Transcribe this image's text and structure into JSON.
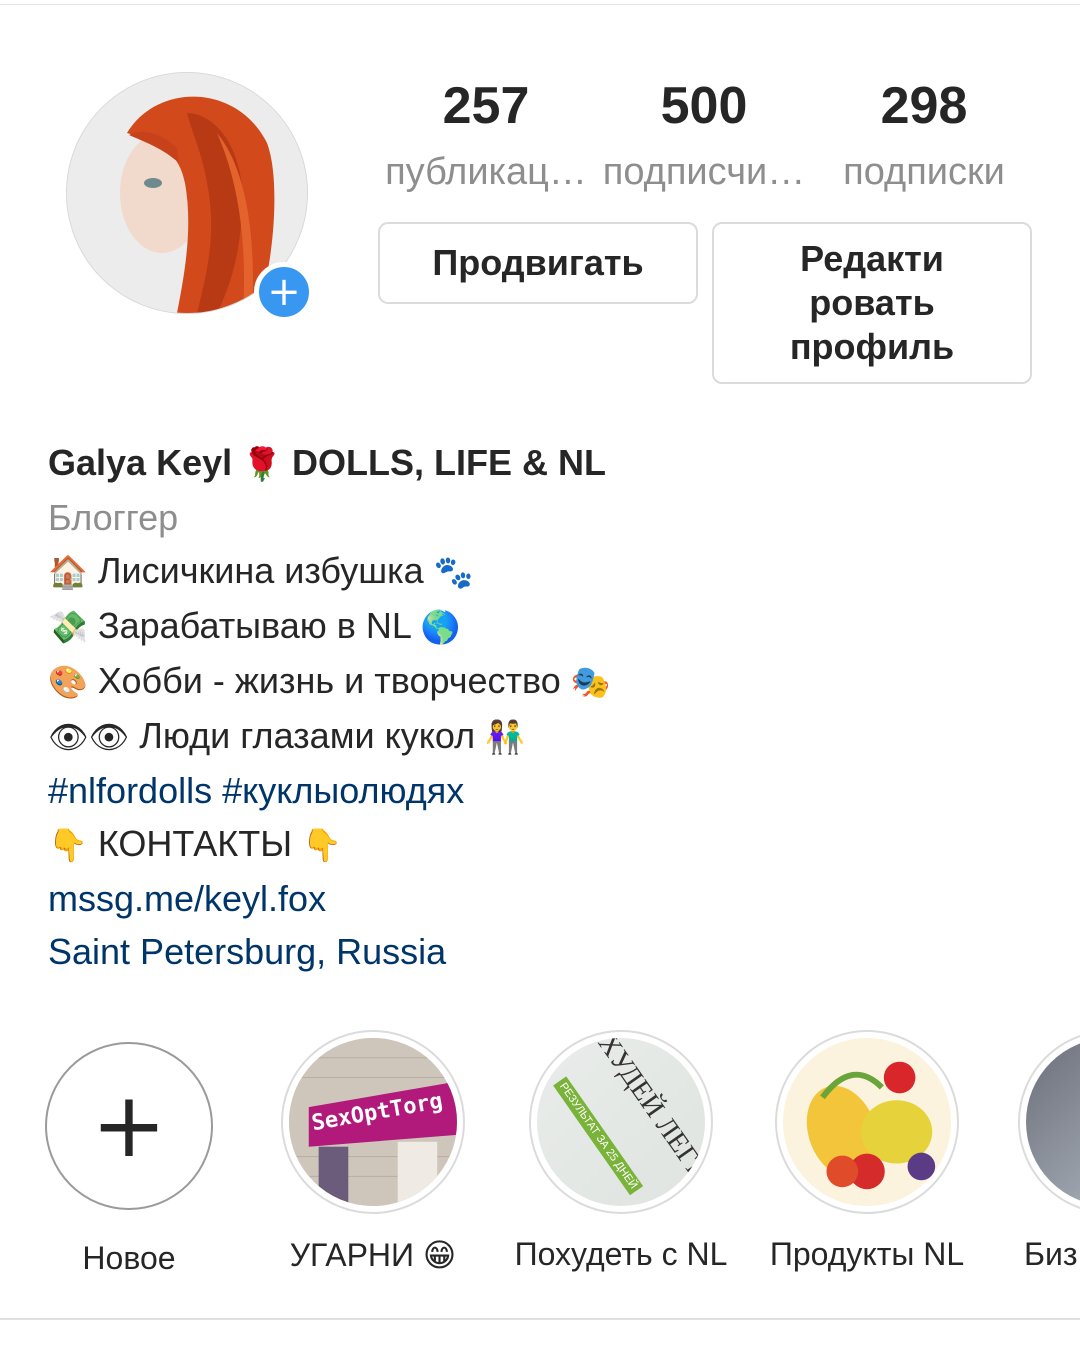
{
  "profile": {
    "stats": [
      {
        "value": "257",
        "label": "публикац…"
      },
      {
        "value": "500",
        "label": "подписчи…"
      },
      {
        "value": "298",
        "label": "подписки"
      }
    ],
    "buttons": {
      "promote": "Продвигать",
      "edit": "Редакти\nровать\nпрофиль"
    },
    "add_icon": "plus-icon"
  },
  "bio": {
    "name": "Galya Keyl",
    "name_emoji": "🌹",
    "name_rest": "DOLLS, LIFE & NL",
    "category": "Блоггер",
    "lines": [
      {
        "emoji_start": "🏠",
        "text": "Лисичкина избушка",
        "emoji_end": "🐾"
      },
      {
        "emoji_start": "💸",
        "text": "Зарабатываю в NL",
        "emoji_end": "🌎"
      },
      {
        "emoji_start": "🎨",
        "text": "Хобби - жизнь и творчество",
        "emoji_end": "🎭"
      },
      {
        "emoji_start": "👁👁",
        "text": "Люди глазами кукол",
        "emoji_end": "👫"
      }
    ],
    "hashtags": "#nlfordolls #куклыолюдях",
    "contacts": {
      "emoji_start": "👇",
      "text": "КОНТАКТЫ",
      "emoji_end": "👇"
    },
    "link": "mssg.me/keyl.fox",
    "location": "Saint Petersburg, Russia"
  },
  "highlights": [
    {
      "label": "Новое"
    },
    {
      "label": "УГАРНИ 😁",
      "cover_text": "SexOptTorg"
    },
    {
      "label": "Похудеть с NL",
      "cover_text": "ХУДЕЙ ЛЕГКО",
      "cover_subtext": "РЕЗУЛЬТАТ ЗА 25 ДНЕЙ"
    },
    {
      "label": "Продукты NL"
    },
    {
      "label": "Биз"
    }
  ],
  "colors": {
    "accent": "#3897f0",
    "link": "#003569",
    "muted": "#8e8e8e",
    "text": "#262626"
  }
}
